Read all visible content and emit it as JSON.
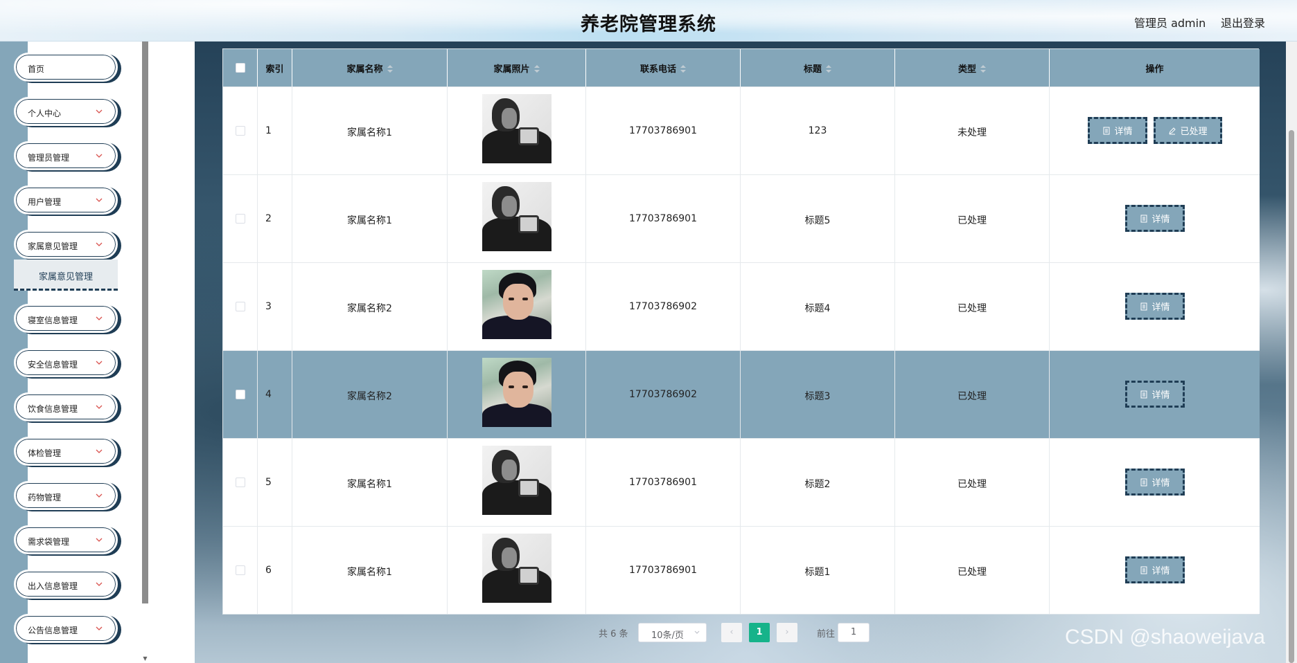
{
  "header": {
    "title": "养老院管理系统",
    "user": "管理员 admin",
    "logout": "退出登录"
  },
  "sidebar": {
    "items": [
      {
        "label": "首页",
        "has_chevron": false
      },
      {
        "label": "个人中心",
        "has_chevron": true
      },
      {
        "label": "管理员管理",
        "has_chevron": true
      },
      {
        "label": "用户管理",
        "has_chevron": true
      },
      {
        "label": "家属意见管理",
        "has_chevron": true
      },
      {
        "label": "寝室信息管理",
        "has_chevron": true
      },
      {
        "label": "安全信息管理",
        "has_chevron": true
      },
      {
        "label": "饮食信息管理",
        "has_chevron": true
      },
      {
        "label": "体检管理",
        "has_chevron": true
      },
      {
        "label": "药物管理",
        "has_chevron": true
      },
      {
        "label": "需求袋管理",
        "has_chevron": true
      },
      {
        "label": "出入信息管理",
        "has_chevron": true
      },
      {
        "label": "公告信息管理",
        "has_chevron": true
      }
    ],
    "submenu": {
      "label": "家属意见管理"
    }
  },
  "table": {
    "columns": [
      "索引",
      "家属名称",
      "家属照片",
      "联系电话",
      "标题",
      "类型",
      "操作"
    ],
    "rows": [
      {
        "index": "1",
        "name": "家属名称1",
        "photo": "bw",
        "phone": "17703786901",
        "title": "123",
        "type": "未处理",
        "actions": [
          "详情",
          "已处理"
        ]
      },
      {
        "index": "2",
        "name": "家属名称1",
        "photo": "bw",
        "phone": "17703786901",
        "title": "标题5",
        "type": "已处理",
        "actions": [
          "详情"
        ]
      },
      {
        "index": "3",
        "name": "家属名称2",
        "photo": "color",
        "phone": "17703786902",
        "title": "标题4",
        "type": "已处理",
        "actions": [
          "详情"
        ]
      },
      {
        "index": "4",
        "name": "家属名称2",
        "photo": "color",
        "phone": "17703786902",
        "title": "标题3",
        "type": "已处理",
        "actions": [
          "详情"
        ],
        "highlighted": true
      },
      {
        "index": "5",
        "name": "家属名称1",
        "photo": "bw",
        "phone": "17703786901",
        "title": "标题2",
        "type": "已处理",
        "actions": [
          "详情"
        ]
      },
      {
        "index": "6",
        "name": "家属名称1",
        "photo": "bw",
        "phone": "17703786901",
        "title": "标题1",
        "type": "已处理",
        "actions": [
          "详情"
        ]
      }
    ]
  },
  "pagination": {
    "total": "共 6 条",
    "page_size": "10条/页",
    "current_page": "1",
    "goto_label": "前往",
    "goto_value": "1"
  },
  "watermark": "CSDN @shaoweijava",
  "colors": {
    "accent": "#84a6b9",
    "dark": "#1f3d55",
    "active_page": "#16b38a"
  }
}
